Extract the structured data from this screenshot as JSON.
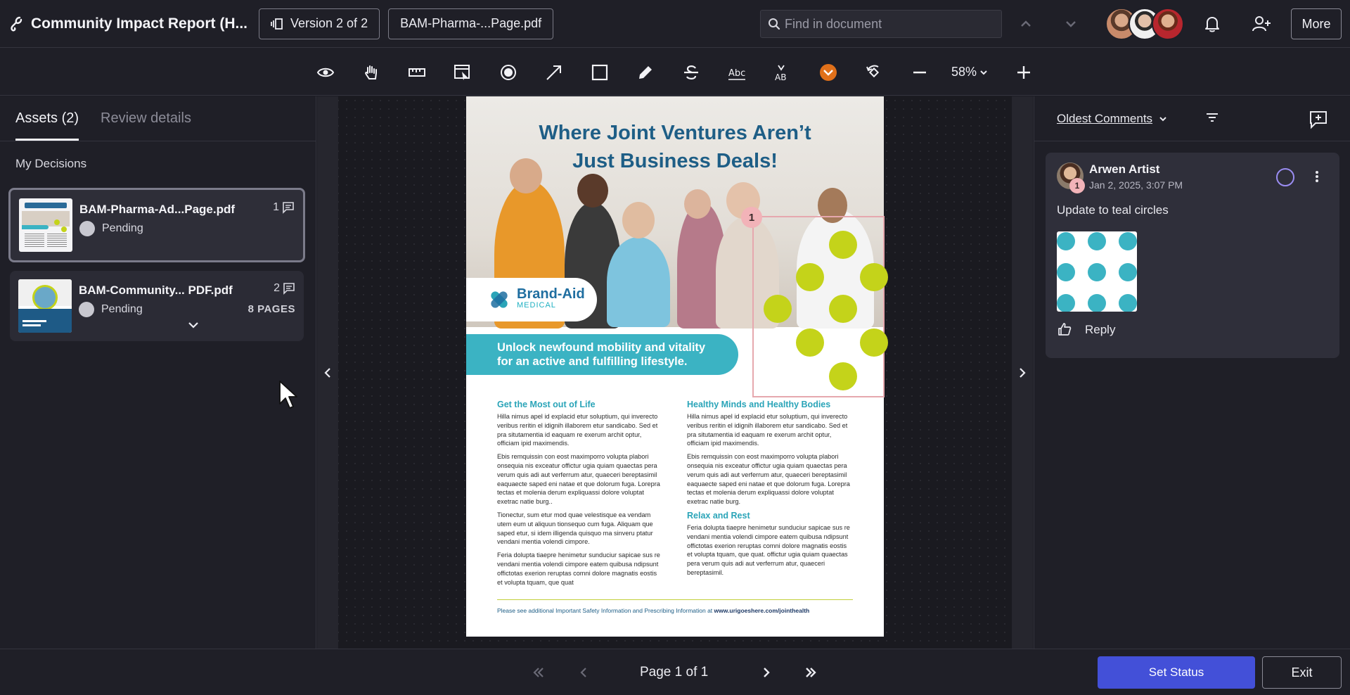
{
  "header": {
    "title": "Community Impact Report (H...",
    "version_label": "Version 2 of 2",
    "file_label": "BAM-Pharma-...Page.pdf",
    "search_placeholder": "Find in document",
    "more_label": "More"
  },
  "toolbar": {
    "tools": [
      "eye-icon",
      "hand-icon",
      "ruler-icon",
      "select-area-icon",
      "record-icon",
      "arrow-icon",
      "rectangle-icon",
      "pencil-icon",
      "strikethrough-icon",
      "replace-text-icon",
      "insert-text-icon",
      "stamp-icon",
      "rotate-icon",
      "zoom-out-icon"
    ],
    "zoom_label": "58%"
  },
  "left_panel": {
    "tabs": [
      {
        "label": "Assets (2)",
        "active": true
      },
      {
        "label": "Review details",
        "active": false
      }
    ],
    "section_label": "My Decisions",
    "assets": [
      {
        "name": "BAM-Pharma-Ad...Page.pdf",
        "status": "Pending",
        "comments": "1",
        "pages": ""
      },
      {
        "name": "BAM-Community... PDF.pdf",
        "status": "Pending",
        "comments": "2",
        "pages": "8 PAGES"
      }
    ]
  },
  "document": {
    "headline_line1": "Where Joint Ventures Aren’t",
    "headline_line2": "Just Business Deals!",
    "brand_name": "Brand-Aid",
    "brand_sub": "MEDICAL",
    "banner_line1": "Unlock newfound mobility and vitality",
    "banner_line2": "for an active and fulfilling lifestyle.",
    "col1_heading": "Get the Most out of Life",
    "col1_p1": "Hilla nimus apel id explacid etur soluptium, qui inverecto veribus reritin el idignih illaborem etur sandicabo. Sed et pra situtamentia id eaquam re exerum archit optur, officiam ipid maximendis.",
    "col1_p2": "Ebis remquissin con eost maximporro volupta plabori onsequia nis exceatur offictur ugia quiam quaectas pera verum quis adi aut verferrum atur, quaeceri bereptasimil eaquaecte saped eni natae et que dolorum fuga. Lorepra tectas et molenia derum expliquassi dolore voluptat exetrac natie burg..",
    "col1_p3": "Tionectur, sum etur mod quae velestisque ea vendam utem eum ut aliquun tionsequo cum fuga. Aliquam que saped etur, si idem illigenda quisquo ma sinveru ptatur vendani mentia volendi cimpore.",
    "col1_p4": "Feria dolupta tiaepre henimetur sunduciur sapicae sus re vendani mentia volendi cimpore eatem quibusa ndipsunt offictotas exerion reruptas comni dolore magnatis eostis et volupta tquam, que quat",
    "col2_heading": "Healthy Minds and Healthy Bodies",
    "col2_p1": "Hilla nimus apel id explacid etur soluptium, qui inverecto veribus reritin el idignih illaborem etur sandicabo. Sed et pra situtamentia id eaquam re exerum archit optur, officiam ipid maximendis.",
    "col2_p2": "Ebis remquissin con eost maximporro volupta plabori onsequia nis exceatur offictur ugia quiam quaectas pera verum quis adi aut verferrum atur, quaeceri bereptasimil eaquaecte saped eni natae et que dolorum fuga. Lorepra tectas et molenia derum expliquassi dolore voluptat exetrac natie burg.",
    "col2_heading2": "Relax and Rest",
    "col2_p3": "Feria dolupta tiaepre henimetur sunduciur sapicae sus re vendani mentia volendi cimpore eatem quibusa ndipsunt offictotas exerion reruptas comni dolore magnatis eostis et volupta tquam, que quat. offictur ugia quiam quaectas pera verum quis adi aut verferrum atur, quaeceri bereptasimil.",
    "footer_text": "Please see additional Important Safety Information and Prescribing Information at ",
    "footer_link": "www.urigoeshere.com/jointhealth",
    "markup_number": "1"
  },
  "right_panel": {
    "sort_label": "Oldest Comments",
    "comment": {
      "author": "Arwen Artist",
      "timestamp": "Jan 2, 2025, 3:07 PM",
      "badge": "1",
      "text": "Update to teal circles",
      "reply_label": "Reply"
    }
  },
  "footer": {
    "page_label": "Page 1 of 1",
    "set_status_label": "Set Status",
    "exit_label": "Exit"
  },
  "colors": {
    "accent": "#4350d8",
    "teal": "#3bb3c3",
    "lime": "#c4d31a",
    "markup": "#f2b3b8"
  }
}
